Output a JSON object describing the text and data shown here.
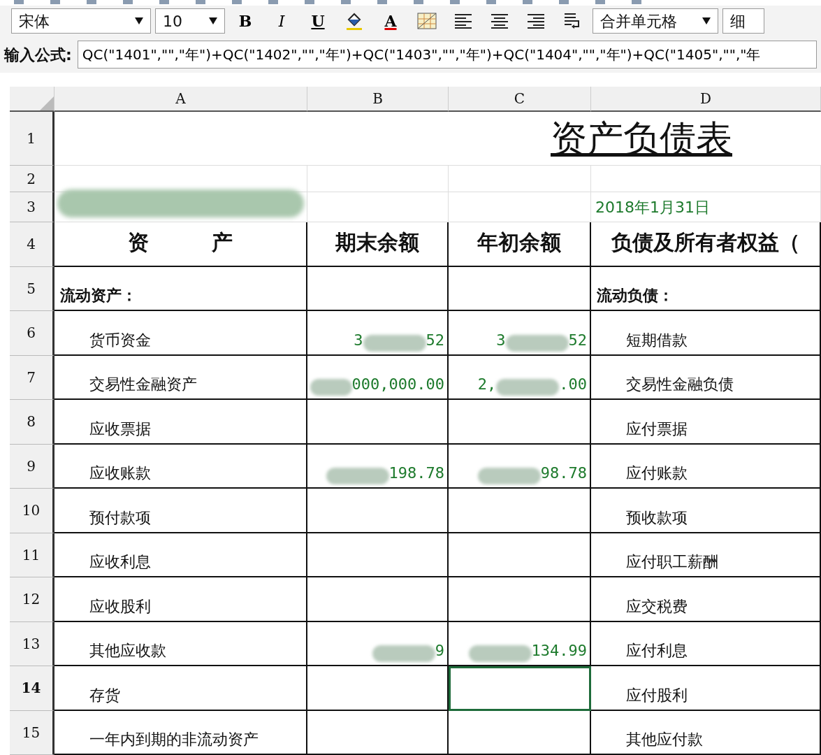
{
  "toolbar": {
    "font": "宋体",
    "size": "10",
    "buttons": [
      {
        "kind": "bold",
        "label": "B"
      },
      {
        "kind": "italic",
        "label": "I"
      },
      {
        "kind": "underline",
        "label": "U"
      },
      {
        "kind": "fill"
      },
      {
        "kind": "fontcolor",
        "label": "A"
      },
      {
        "kind": "border"
      },
      {
        "kind": "align-left"
      },
      {
        "kind": "align-center"
      },
      {
        "kind": "align-right"
      },
      {
        "kind": "wrap"
      }
    ],
    "merge": "合并单元格",
    "line_style": "细"
  },
  "formula_bar": {
    "label": "输入公式:",
    "value": "QC(\"1401\",\"\",\"年\")+QC(\"1402\",\"\",\"年\")+QC(\"1403\",\"\",\"年\")+QC(\"1404\",\"\",\"年\")+QC(\"1405\",\"\",\"年"
  },
  "columns": [
    "A",
    "B",
    "C",
    "D"
  ],
  "title": "资产负债表",
  "rows": [
    {
      "number": "1",
      "selected": false
    },
    {
      "number": "2",
      "selected": false
    },
    {
      "number": "3",
      "selected": false,
      "cells": [
        {
          "kind": "redacted"
        },
        {
          "kind": "empty"
        },
        {
          "kind": "empty"
        },
        {
          "kind": "date",
          "text": "2018年1月31日"
        }
      ]
    },
    {
      "number": "4",
      "selected": false,
      "cells": [
        {
          "kind": "header",
          "text": "资　　　产"
        },
        {
          "kind": "header",
          "text": "期末余额"
        },
        {
          "kind": "header",
          "text": "年初余额"
        },
        {
          "kind": "header",
          "text": "负债及所有者权益（"
        }
      ]
    },
    {
      "number": "5",
      "selected": false,
      "cells": [
        {
          "kind": "section",
          "text": "流动资产："
        },
        {
          "kind": "empty"
        },
        {
          "kind": "empty"
        },
        {
          "kind": "section",
          "text": "流动负债："
        }
      ]
    },
    {
      "number": "6",
      "selected": false,
      "cells": [
        {
          "kind": "item",
          "text": "货币资金"
        },
        {
          "kind": "number",
          "prefix": "3",
          "text": "52",
          "redacted": true
        },
        {
          "kind": "number",
          "prefix": "3",
          "text": "52",
          "redacted": true
        },
        {
          "kind": "item",
          "text": "短期借款"
        }
      ]
    },
    {
      "number": "7",
      "selected": false,
      "cells": [
        {
          "kind": "item",
          "text": "交易性金融资产"
        },
        {
          "kind": "number",
          "text": "000,000.00",
          "redacted": true
        },
        {
          "kind": "number",
          "prefix": "2,",
          "text": ".00",
          "redacted": true
        },
        {
          "kind": "item",
          "text": "交易性金融负债"
        }
      ]
    },
    {
      "number": "8",
      "selected": false,
      "cells": [
        {
          "kind": "item",
          "text": "应收票据"
        },
        {
          "kind": "empty"
        },
        {
          "kind": "empty"
        },
        {
          "kind": "item",
          "text": "应付票据"
        }
      ]
    },
    {
      "number": "9",
      "selected": false,
      "cells": [
        {
          "kind": "item",
          "text": "应收账款"
        },
        {
          "kind": "number",
          "text": "198.78",
          "redacted": true
        },
        {
          "kind": "number",
          "text": "98.78",
          "redacted": true
        },
        {
          "kind": "item",
          "text": "应付账款"
        }
      ]
    },
    {
      "number": "10",
      "selected": false,
      "cells": [
        {
          "kind": "item",
          "text": "预付款项"
        },
        {
          "kind": "empty"
        },
        {
          "kind": "empty"
        },
        {
          "kind": "item",
          "text": "预收款项"
        }
      ]
    },
    {
      "number": "11",
      "selected": false,
      "cells": [
        {
          "kind": "item",
          "text": "应收利息"
        },
        {
          "kind": "empty"
        },
        {
          "kind": "empty"
        },
        {
          "kind": "item",
          "text": "应付职工薪酬"
        }
      ]
    },
    {
      "number": "12",
      "selected": false,
      "cells": [
        {
          "kind": "item",
          "text": "应收股利"
        },
        {
          "kind": "empty"
        },
        {
          "kind": "empty"
        },
        {
          "kind": "item",
          "text": "应交税费"
        }
      ]
    },
    {
      "number": "13",
      "selected": false,
      "cells": [
        {
          "kind": "item",
          "text": "其他应收款"
        },
        {
          "kind": "number",
          "text": "9",
          "redacted": true
        },
        {
          "kind": "number",
          "text": "134.99",
          "redacted": true
        },
        {
          "kind": "item",
          "text": "应付利息"
        }
      ]
    },
    {
      "number": "14",
      "selected": true,
      "cells": [
        {
          "kind": "item",
          "text": "存货"
        },
        {
          "kind": "empty"
        },
        {
          "kind": "empty",
          "selected": true
        },
        {
          "kind": "item",
          "text": "应付股利"
        }
      ]
    },
    {
      "number": "15",
      "selected": false,
      "cells": [
        {
          "kind": "item",
          "text": "一年内到期的非流动资产"
        },
        {
          "kind": "empty"
        },
        {
          "kind": "empty"
        },
        {
          "kind": "item",
          "text": "其他应付款"
        }
      ]
    }
  ]
}
